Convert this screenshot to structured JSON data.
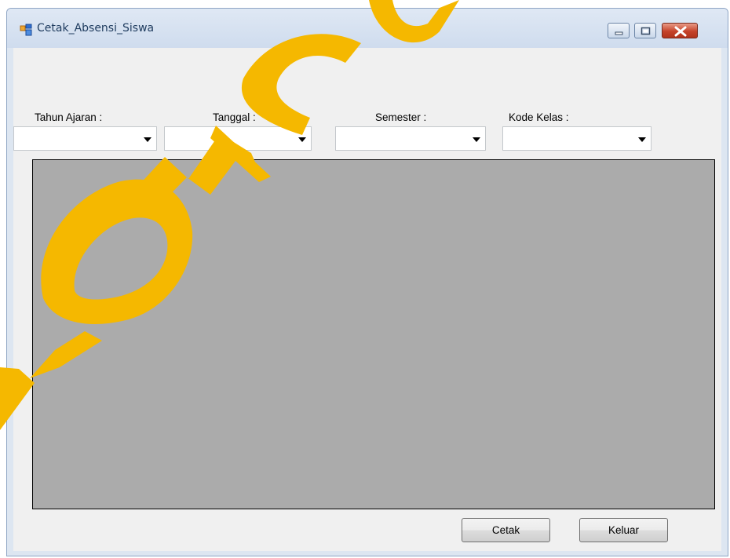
{
  "window": {
    "title": "Cetak_Absensi_Siswa"
  },
  "filters": {
    "tahun_ajaran_label": "Tahun Ajaran :",
    "tanggal_label": "Tanggal :",
    "semester_label": "Semester :",
    "kode_kelas_label": "Kode Kelas :",
    "tahun_ajaran_value": "",
    "tanggal_value": "",
    "semester_value": "",
    "kode_kelas_value": ""
  },
  "buttons": {
    "cetak_label": "Cetak",
    "keluar_label": "Keluar"
  },
  "colors": {
    "viewer_background": "#ababab",
    "watermark": "#f5b800",
    "window_frame": "#dde6f1"
  },
  "icons": {
    "app": "app-icon",
    "minimize": "minimize-icon",
    "maximize": "maximize-icon",
    "close": "close-icon",
    "dropdown": "chevron-down-icon"
  }
}
